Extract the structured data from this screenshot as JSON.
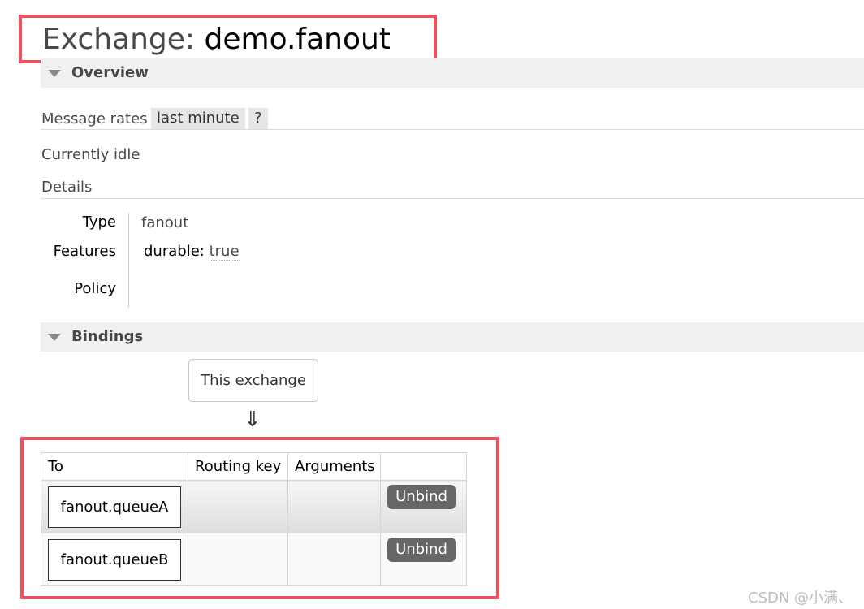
{
  "title": {
    "prefix": "Exchange:",
    "name": "demo.fanout"
  },
  "overview": {
    "header": "Overview",
    "message_rates_label": "Message rates",
    "range_label": "last minute",
    "help_label": "?",
    "status": "Currently idle",
    "details_label": "Details",
    "details": {
      "type_label": "Type",
      "type_value": "fanout",
      "features_label": "Features",
      "durable_key": "durable:",
      "durable_value": "true",
      "policy_label": "Policy"
    }
  },
  "bindings": {
    "header": "Bindings",
    "source_label": "This exchange",
    "arrow": "⇓",
    "columns": [
      "To",
      "Routing key",
      "Arguments",
      ""
    ],
    "rows": [
      {
        "to": "fanout.queueA",
        "routing_key": "",
        "arguments": "",
        "action": "Unbind"
      },
      {
        "to": "fanout.queueB",
        "routing_key": "",
        "arguments": "",
        "action": "Unbind"
      }
    ]
  },
  "watermark": "CSDN @小满、",
  "colors": {
    "annotation": "#e9535d",
    "button": "#666666",
    "section_bg": "#f0f0f0"
  }
}
